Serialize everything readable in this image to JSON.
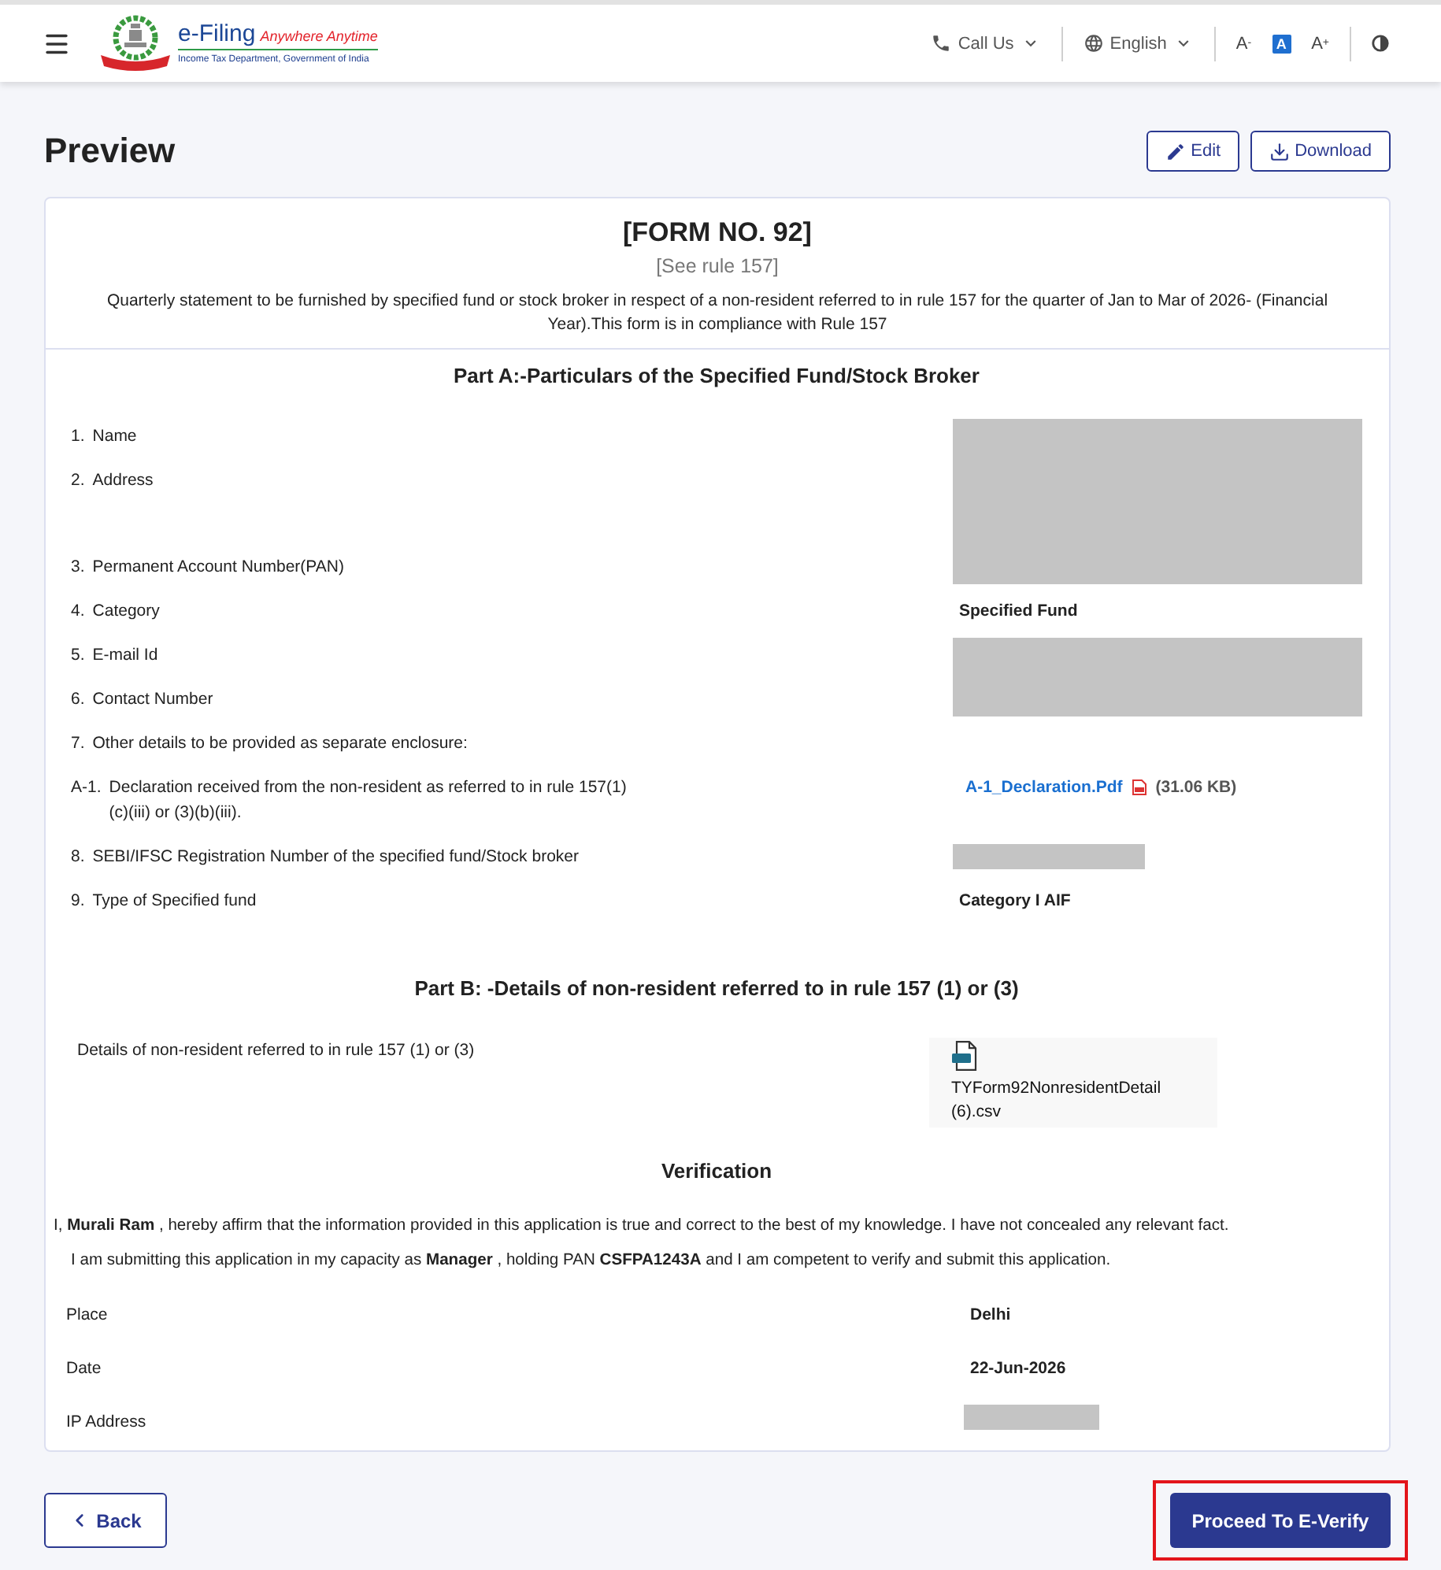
{
  "header": {
    "logo": {
      "title": "e-Filing",
      "tagline": "Anywhere Anytime",
      "subtitle": "Income Tax Department, Government of India"
    },
    "call_us": "Call Us",
    "language": "English",
    "font_size_options": [
      {
        "label": "A$^{-}$",
        "selected": false
      },
      {
        "label": "A",
        "selected": true
      },
      {
        "label": "A$^{+}$",
        "selected": false
      }
    ]
  },
  "page_title": "Preview",
  "actions": [
    {
      "kind": "edit",
      "label": "Edit"
    },
    {
      "kind": "download",
      "label": "Download"
    }
  ],
  "form": {
    "title": "[FORM NO. 92]",
    "rule": "[See rule 157]",
    "description": "Quarterly statement to be furnished by specified fund or stock broker in respect of a non-resident referred to in rule 157 for the quarter of Jan to Mar of 2026- (Financial Year).This form is in compliance with Rule 157",
    "part_a": {
      "title": "Part A:-Particulars of the Specified Fund/Stock Broker",
      "groups": [
        {
          "rows": [
            {
              "number": "1.",
              "label": "Name"
            },
            {
              "number": "2.",
              "label": "Address"
            },
            {
              "number": "3.",
              "label": "Permanent Account Number(PAN)"
            }
          ],
          "value": {
            "kind": "redacted"
          }
        },
        {
          "rows": [
            {
              "number": "4.",
              "label": "Category"
            }
          ],
          "value": {
            "kind": "text",
            "text": "Specified Fund"
          }
        },
        {
          "rows": [
            {
              "number": "5.",
              "label": "E-mail Id"
            },
            {
              "number": "6.",
              "label": "Contact Number"
            }
          ],
          "value": {
            "kind": "redacted"
          }
        },
        {
          "rows": [
            {
              "number": "7.",
              "label": "Other details to be provided as separate enclosure:"
            }
          ]
        },
        {
          "rows": [
            {
              "number": "A-1.",
              "label": "Declaration received from the non-resident as referred to in rule 157(1)\n(c)(iii) or (3)(b)(iii)."
            }
          ],
          "value": {
            "kind": "file",
            "name": "A-1_Declaration.Pdf",
            "size": "(31.06 KB)"
          }
        },
        {
          "rows": [
            {
              "number": "8.",
              "label": "SEBI/IFSC Registration Number of the specified fund/Stock broker"
            }
          ],
          "value": {
            "kind": "redacted_line"
          }
        },
        {
          "rows": [
            {
              "number": "9.",
              "label": "Type of Specified fund"
            }
          ],
          "value": {
            "kind": "text",
            "text": "Category I AIF"
          }
        }
      ]
    },
    "part_b": {
      "title": "Part B: -Details of non-resident referred to in rule 157 (1) or (3)",
      "rows": [
        {
          "label": "Details of non-resident referred to in rule 157 (1) or (3)",
          "file": "TYForm92NonresidentDetail (6).csv"
        }
      ]
    },
    "verification": {
      "title": "Verification",
      "statements": [
        "I, **Murali Ram** , hereby affirm that the information provided in this application is true and correct to the best of my knowledge. I have not concealed any relevant fact.",
        "I am submitting this application in my capacity as **Manager** , holding PAN **CSFPA1243A** and I am competent to verify and submit this application."
      ],
      "rows": [
        {
          "label": "Place",
          "value": {
            "kind": "text",
            "text": "Delhi"
          }
        },
        {
          "label": "Date",
          "value": {
            "kind": "text",
            "text": "22-Jun-2026"
          }
        },
        {
          "label": "IP Address",
          "value": {
            "kind": "redacted_line"
          }
        }
      ]
    }
  },
  "footer": {
    "back": "Back",
    "proceed": {
      "label": "Proceed To E-Verify",
      "highlighted": true
    }
  }
}
